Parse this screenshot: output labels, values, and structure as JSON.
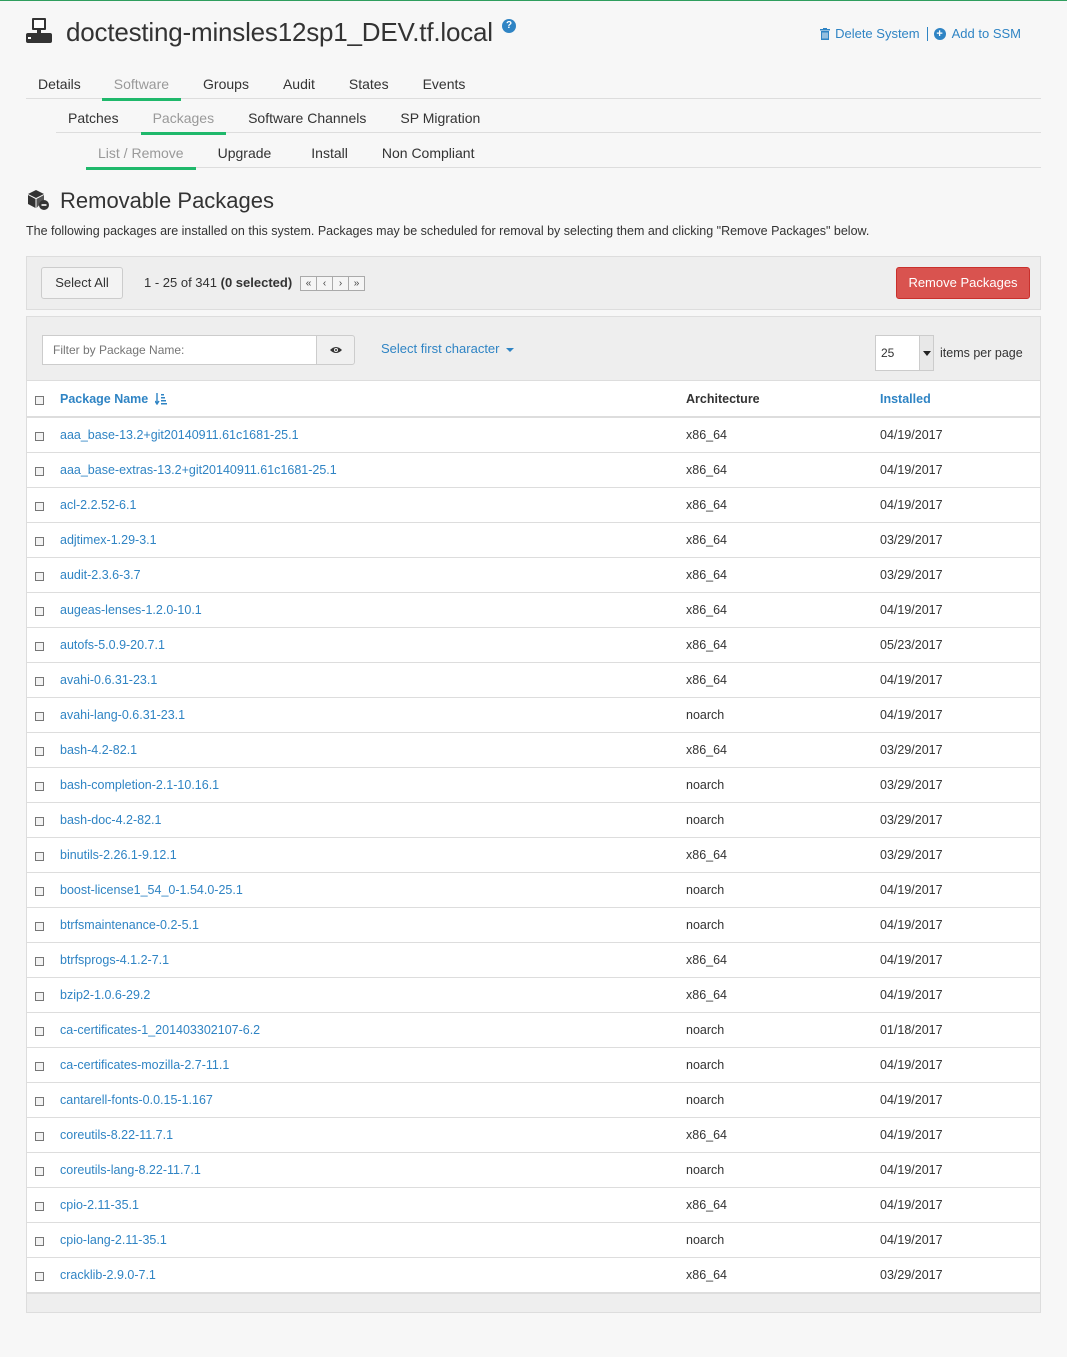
{
  "header": {
    "system_name": "doctesting-minsles12sp1_DEV.tf.local",
    "help": "?",
    "delete_system": "Delete System",
    "add_to_ssm": "Add to SSM"
  },
  "tabs_primary": [
    "Details",
    "Software",
    "Groups",
    "Audit",
    "States",
    "Events"
  ],
  "tabs_secondary": [
    "Patches",
    "Packages",
    "Software Channels",
    "SP Migration"
  ],
  "tabs_tertiary": [
    "List / Remove",
    "Upgrade",
    "Install",
    "Non Compliant"
  ],
  "section": {
    "title": "Removable Packages",
    "description": "The following packages are installed on this system. Packages may be scheduled for removal by selecting them and clicking \"Remove Packages\" below."
  },
  "toolbar": {
    "select_all": "Select All",
    "range": "1 - 25 of 341",
    "selected": "(0 selected)",
    "pager": [
      "«",
      "‹",
      "›",
      "»"
    ],
    "remove": "Remove Packages"
  },
  "filter": {
    "placeholder": "Filter by Package Name:",
    "first_char": "Select first character",
    "per_page": "25",
    "per_page_label": "items per page"
  },
  "table": {
    "headers": {
      "name": "Package Name",
      "arch": "Architecture",
      "installed": "Installed"
    },
    "rows": [
      [
        "aaa_base-13.2+git20140911.61c1681-25.1",
        "x86_64",
        "04/19/2017"
      ],
      [
        "aaa_base-extras-13.2+git20140911.61c1681-25.1",
        "x86_64",
        "04/19/2017"
      ],
      [
        "acl-2.2.52-6.1",
        "x86_64",
        "04/19/2017"
      ],
      [
        "adjtimex-1.29-3.1",
        "x86_64",
        "03/29/2017"
      ],
      [
        "audit-2.3.6-3.7",
        "x86_64",
        "03/29/2017"
      ],
      [
        "augeas-lenses-1.2.0-10.1",
        "x86_64",
        "04/19/2017"
      ],
      [
        "autofs-5.0.9-20.7.1",
        "x86_64",
        "05/23/2017"
      ],
      [
        "avahi-0.6.31-23.1",
        "x86_64",
        "04/19/2017"
      ],
      [
        "avahi-lang-0.6.31-23.1",
        "noarch",
        "04/19/2017"
      ],
      [
        "bash-4.2-82.1",
        "x86_64",
        "03/29/2017"
      ],
      [
        "bash-completion-2.1-10.16.1",
        "noarch",
        "03/29/2017"
      ],
      [
        "bash-doc-4.2-82.1",
        "noarch",
        "03/29/2017"
      ],
      [
        "binutils-2.26.1-9.12.1",
        "x86_64",
        "03/29/2017"
      ],
      [
        "boost-license1_54_0-1.54.0-25.1",
        "noarch",
        "04/19/2017"
      ],
      [
        "btrfsmaintenance-0.2-5.1",
        "noarch",
        "04/19/2017"
      ],
      [
        "btrfsprogs-4.1.2-7.1",
        "x86_64",
        "04/19/2017"
      ],
      [
        "bzip2-1.0.6-29.2",
        "x86_64",
        "04/19/2017"
      ],
      [
        "ca-certificates-1_201403302107-6.2",
        "noarch",
        "01/18/2017"
      ],
      [
        "ca-certificates-mozilla-2.7-11.1",
        "noarch",
        "04/19/2017"
      ],
      [
        "cantarell-fonts-0.0.15-1.167",
        "noarch",
        "04/19/2017"
      ],
      [
        "coreutils-8.22-11.7.1",
        "x86_64",
        "04/19/2017"
      ],
      [
        "coreutils-lang-8.22-11.7.1",
        "noarch",
        "04/19/2017"
      ],
      [
        "cpio-2.11-35.1",
        "x86_64",
        "04/19/2017"
      ],
      [
        "cpio-lang-2.11-35.1",
        "noarch",
        "04/19/2017"
      ],
      [
        "cracklib-2.9.0-7.1",
        "x86_64",
        "03/29/2017"
      ]
    ]
  }
}
